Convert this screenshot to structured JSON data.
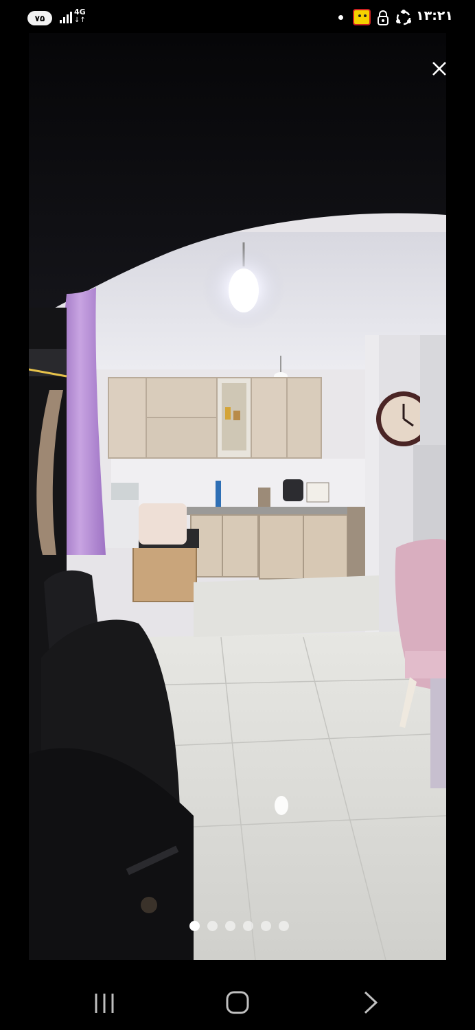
{
  "status_bar": {
    "battery_level": "۷۵",
    "network_type": "4G",
    "network_arrows": "↓↑",
    "time": "۱۳:۲۱",
    "icons": [
      "signal-icon",
      "notification-dot-icon",
      "app-notification-icon",
      "lock-icon",
      "sync-icon"
    ]
  },
  "viewer": {
    "close_icon": "close-icon",
    "image_subject": "kitchen-interior-photo",
    "pager": {
      "total": 6,
      "active_index": 0
    }
  },
  "nav_bar": {
    "icons": [
      "recents-icon",
      "home-icon",
      "back-icon"
    ]
  },
  "colors": {
    "background": "#000000",
    "wall": "#e7e4e8",
    "floor": "#dcdcd9",
    "cabinet": "#d9cbb9",
    "curtain": "#b58fd0",
    "chair_pink": "#d9aebf"
  }
}
